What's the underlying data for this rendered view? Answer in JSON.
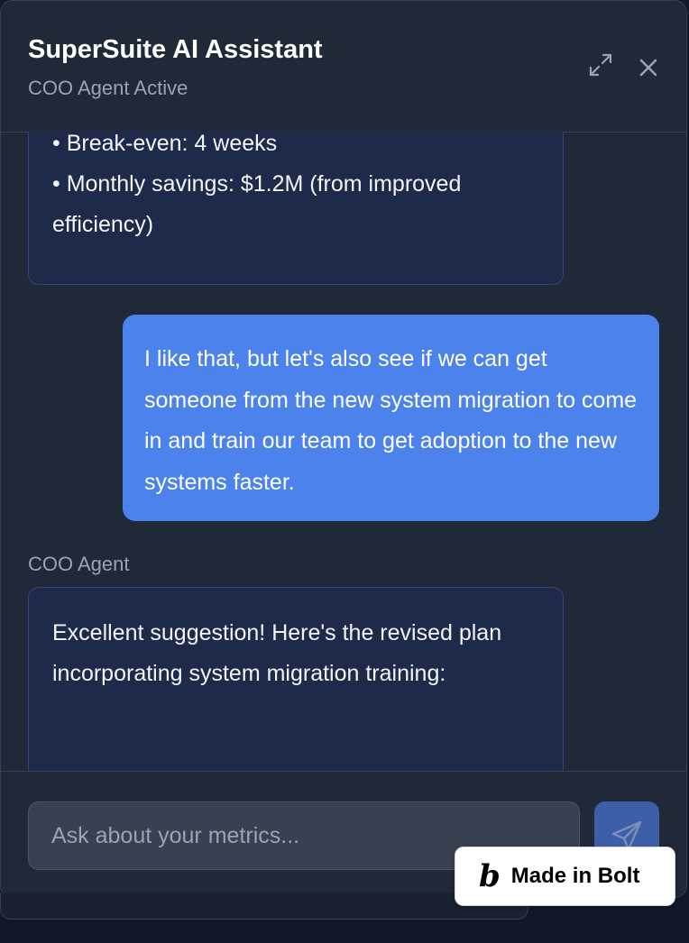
{
  "header": {
    "title": "SuperSuite AI Assistant",
    "subtitle": "COO Agent Active"
  },
  "messages": {
    "agent_top": {
      "lines": [
        "• Break-even: 4 weeks",
        "• Monthly savings: $1.2M (from improved",
        "efficiency)"
      ]
    },
    "user": {
      "text": "I like that, but let's also see if we can get someone from the new system migration to come in and train our team to get adoption to the new systems faster."
    },
    "agent_bottom": {
      "sender": "COO Agent",
      "text": "Excellent suggestion! Here's the revised plan incorporating system migration training:"
    }
  },
  "composer": {
    "placeholder": "Ask about your metrics..."
  },
  "badge": {
    "logo": "b",
    "label": "Made in Bolt"
  },
  "icons": {
    "expand": "expand-icon",
    "close": "close-icon",
    "send": "send-icon"
  },
  "colors": {
    "panel_bg": "#1f2937",
    "agent_bubble_bg": "#1e2a4a",
    "user_bubble_bg": "#4b82ec",
    "send_button_bg": "#3d5fa8"
  }
}
